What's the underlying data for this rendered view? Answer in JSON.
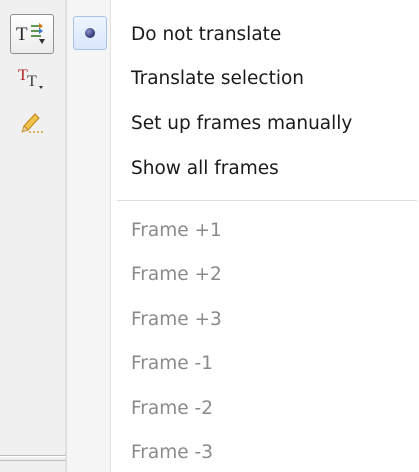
{
  "toolbar": {
    "buttons": [
      {
        "icon": "translate-frames-icon",
        "active": true
      },
      {
        "icon": "text-frame-icon",
        "active": false
      },
      {
        "icon": "pencil-icon",
        "active": false
      }
    ]
  },
  "menu": {
    "items": [
      {
        "label": "Do not translate",
        "selected": true,
        "enabled": true
      },
      {
        "label": "Translate selection",
        "selected": false,
        "enabled": true
      },
      {
        "label": "Set up frames manually",
        "selected": false,
        "enabled": true
      },
      {
        "label": "Show all frames",
        "selected": false,
        "enabled": true
      }
    ],
    "frames": [
      {
        "label": "Frame +1",
        "enabled": false
      },
      {
        "label": "Frame +2",
        "enabled": false
      },
      {
        "label": "Frame +3",
        "enabled": false
      },
      {
        "label": "Frame -1",
        "enabled": false
      },
      {
        "label": "Frame -2",
        "enabled": false
      },
      {
        "label": "Frame -3",
        "enabled": false
      }
    ]
  }
}
